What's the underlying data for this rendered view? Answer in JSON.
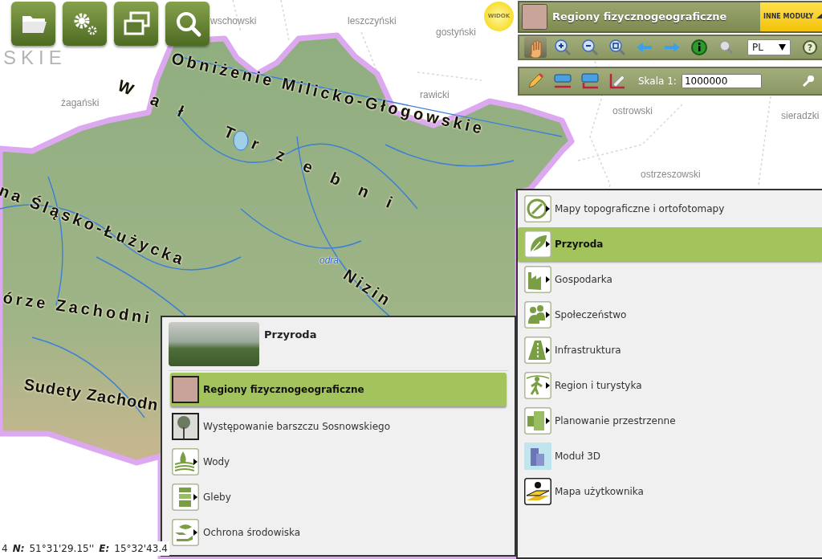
{
  "view_badge": "WIDOK",
  "header": {
    "title": "Regiony fizycznogeograficzne",
    "other_modules": "INNE MODUŁY"
  },
  "map_tools": [
    {
      "kind": "pan",
      "selected": true
    },
    {
      "kind": "zoom-in",
      "selected": false
    },
    {
      "kind": "zoom-out",
      "selected": false
    },
    {
      "kind": "zoom-extent",
      "selected": false
    },
    {
      "kind": "back",
      "selected": false
    },
    {
      "kind": "forward",
      "selected": false
    },
    {
      "kind": "info",
      "selected": false
    },
    {
      "kind": "search",
      "selected": false
    }
  ],
  "language": "PL",
  "help": "?",
  "scale": {
    "label": "Skala 1:",
    "value": "1000000"
  },
  "map_labels": [
    {
      "kind": "voivodeship",
      "text": "SKIE"
    },
    {
      "kind": "county",
      "text": "wschowski"
    },
    {
      "kind": "county",
      "text": "leszczyński"
    },
    {
      "kind": "county",
      "text": "gostyński"
    },
    {
      "kind": "county",
      "text": "żagański"
    },
    {
      "kind": "county",
      "text": "rawicki"
    },
    {
      "kind": "county",
      "text": "ostrowski"
    },
    {
      "kind": "county",
      "text": "sieradzki"
    },
    {
      "kind": "county",
      "text": "ostrzeszowski"
    },
    {
      "kind": "region",
      "text": "Obniżenie Milicko-Głogowskie"
    },
    {
      "kind": "region-wide",
      "text": "Wał Trzebni"
    },
    {
      "kind": "region",
      "text": "na Śląsko-Łużycka"
    },
    {
      "kind": "region",
      "text": "órze Zachodni"
    },
    {
      "kind": "region",
      "text": "Sudety Zachodn"
    },
    {
      "kind": "region",
      "text": "Nizin"
    },
    {
      "kind": "river",
      "text": "odra"
    }
  ],
  "category_menu": [
    {
      "label": "Mapy topograficzne i ortofotomapy",
      "selected": false
    },
    {
      "label": "Przyroda",
      "selected": true
    },
    {
      "label": "Gospodarka",
      "selected": false
    },
    {
      "label": "Społeczeństwo",
      "selected": false
    },
    {
      "label": "Infrastruktura",
      "selected": false
    },
    {
      "label": "Region i turystyka",
      "selected": false
    },
    {
      "label": "Planowanie przestrzenne",
      "selected": false
    },
    {
      "label": "Moduł 3D",
      "selected": false
    },
    {
      "label": "Mapa użytkownika",
      "selected": false
    }
  ],
  "subcategory_panel": {
    "title": "Przyroda",
    "items": [
      {
        "label": "Regiony fizycznogeograficzne",
        "selected": true
      },
      {
        "label": "Występowanie barszczu Sosnowskiego",
        "selected": false
      },
      {
        "label": "Wody",
        "selected": false
      },
      {
        "label": "Gleby",
        "selected": false
      },
      {
        "label": "Ochrona środowiska",
        "selected": false
      }
    ]
  },
  "status_bar": {
    "prefix": "4",
    "lat_label": "N:",
    "lat": "51°31'29.15''",
    "lon_label": "E:",
    "lon": "15°32'43.4"
  }
}
